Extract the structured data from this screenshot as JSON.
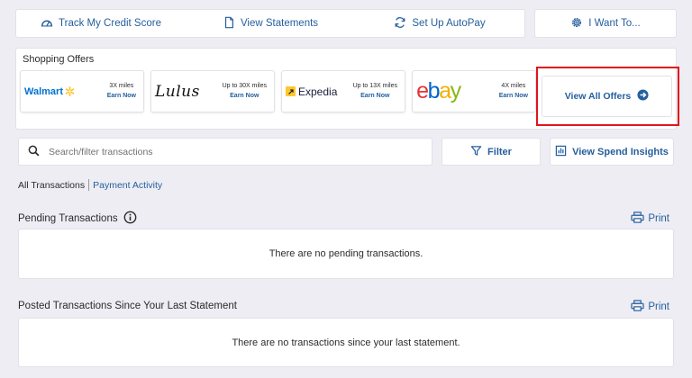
{
  "topbar": {
    "track_credit": "Track My Credit Score",
    "view_statements": "View Statements",
    "autopay": "Set Up AutoPay",
    "i_want": "I Want To..."
  },
  "offers": {
    "title": "Shopping Offers",
    "items": [
      {
        "brand": "Walmart",
        "miles": "3X miles",
        "action": "Earn Now"
      },
      {
        "brand": "Lulus",
        "miles": "Up to 30X miles",
        "action": "Earn Now"
      },
      {
        "brand": "Expedia",
        "miles": "Up to 13X miles",
        "action": "Earn Now"
      },
      {
        "brand": "ebay",
        "miles": "4X miles",
        "action": "Earn Now"
      }
    ],
    "view_all": "View All Offers"
  },
  "search": {
    "placeholder": "Search/filter transactions"
  },
  "filter_label": "Filter",
  "insights_label": "View Spend Insights",
  "tabs": {
    "all": "All Transactions",
    "payment": "Payment Activity"
  },
  "pending": {
    "title": "Pending Transactions",
    "print": "Print",
    "empty": "There are no pending transactions."
  },
  "posted": {
    "title": "Posted Transactions Since Your Last Statement",
    "print": "Print",
    "empty": "There are no transactions since your last statement."
  },
  "colors": {
    "accent": "#255f9e",
    "highlight": "#e0141d",
    "background": "#eeedf3"
  }
}
